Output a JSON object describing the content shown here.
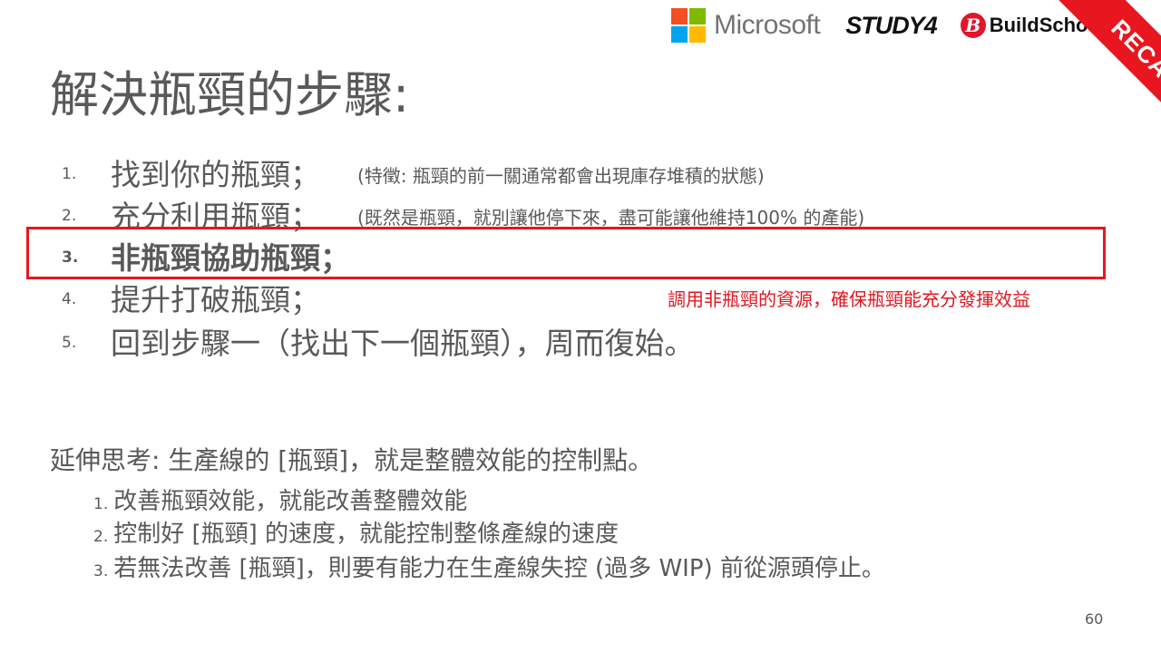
{
  "logos": {
    "microsoft_text": "Microsoft",
    "microsoft_colors": [
      "#f25022",
      "#7fba00",
      "#00a4ef",
      "#ffb900"
    ],
    "study4_text": "STUDY4",
    "buildschool_mark": "B",
    "buildschool_text": "BuildSchool",
    "recap": "RECAP",
    "recap_color": "#e8161f"
  },
  "title": "解決瓶頸的步驟:",
  "steps": [
    {
      "num": "1.",
      "text": "找到你的瓶頸；",
      "note": "(特徵: 瓶頸的前一關通常都會出現庫存堆積的狀態)"
    },
    {
      "num": "2.",
      "text": "充分利用瓶頸；",
      "note": "(既然是瓶頸，就別讓他停下來，盡可能讓他維持100% 的產能)"
    },
    {
      "num": "3.",
      "text": "非瓶頸協助瓶頸；"
    },
    {
      "num": "4.",
      "text": "提升打破瓶頸；"
    },
    {
      "num": "5.",
      "text": "回到步驟一（找出下一個瓶頸），周而復始。"
    }
  ],
  "highlight_note": "調用非瓶頸的資源，確保瓶頸能充分發揮效益",
  "extension": {
    "title": "延伸思考: 生產線的 [瓶頸]，就是整體效能的控制點。",
    "items": [
      {
        "num": "1.",
        "text": "改善瓶頸效能，就能改善整體效能"
      },
      {
        "num": "2.",
        "text": "控制好 [瓶頸] 的速度，就能控制整條產線的速度"
      },
      {
        "num": "3.",
        "text": "若無法改善 [瓶頸]，則要有能力在生產線失控 (過多 WIP) 前從源頭停止。"
      }
    ]
  },
  "page_number": "60"
}
